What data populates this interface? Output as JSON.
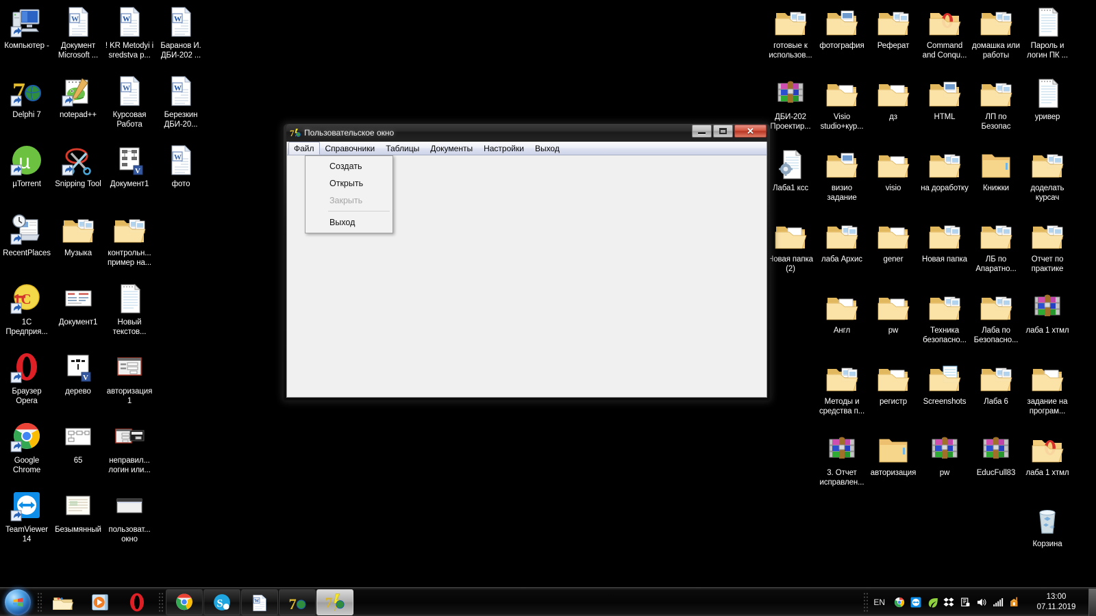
{
  "desktop": {
    "left_icons": [
      {
        "label": "Компьютер -",
        "icon": "computer-icon"
      },
      {
        "label": "Документ Microsoft ...",
        "icon": "word-document-icon"
      },
      {
        "label": "! KR Metodyi i sredstva p...",
        "icon": "word-doc-blue-icon"
      },
      {
        "label": "Баранов И. ДБИ-202 ...",
        "icon": "word-doc-blue-icon"
      },
      {
        "label": "Delphi 7",
        "icon": "delphi-icon"
      },
      {
        "label": "notepad++",
        "icon": "notepadpp-icon"
      },
      {
        "label": "Курсовая Работа",
        "icon": "word-document-icon"
      },
      {
        "label": "Березкин ДБИ-20...",
        "icon": "word-doc-blue-icon"
      },
      {
        "label": "µTorrent",
        "icon": "utorrent-icon"
      },
      {
        "label": "Snipping Tool",
        "icon": "snipping-tool-icon"
      },
      {
        "label": "Документ1",
        "icon": "visio-document-icon"
      },
      {
        "label": "фото",
        "icon": "word-document-icon"
      },
      {
        "label": "RecentPlaces",
        "icon": "recent-places-icon"
      },
      {
        "label": "Музыка",
        "icon": "folder-icon"
      },
      {
        "label": "контрольн... пример на...",
        "icon": "folder-icon"
      },
      {
        "label": "",
        "icon": "none"
      },
      {
        "label": "1С Предприя...",
        "icon": "1c-icon"
      },
      {
        "label": "Документ1",
        "icon": "image-thumb-icon"
      },
      {
        "label": "Новый текстов...",
        "icon": "text-file-icon"
      },
      {
        "label": "",
        "icon": "none"
      },
      {
        "label": "Браузер Opera",
        "icon": "opera-icon"
      },
      {
        "label": "дерево",
        "icon": "visio-thumb-icon"
      },
      {
        "label": "авторизация 1",
        "icon": "screenshot-thumb-icon"
      },
      {
        "label": "",
        "icon": "none"
      },
      {
        "label": "Google Chrome",
        "icon": "chrome-icon"
      },
      {
        "label": "65",
        "icon": "diagram-thumb-icon"
      },
      {
        "label": "неправил... логин или...",
        "icon": "dialog-thumb-icon"
      },
      {
        "label": "",
        "icon": "none"
      },
      {
        "label": "TeamViewer 14",
        "icon": "teamviewer-icon"
      },
      {
        "label": "Безымянный",
        "icon": "paper-thumb-icon"
      },
      {
        "label": "пользоват... окно",
        "icon": "window-thumb-icon"
      },
      {
        "label": "",
        "icon": "none"
      }
    ],
    "right_icons": [
      {
        "label": "готовые к использов...",
        "icon": "folder-icon"
      },
      {
        "label": "фотография",
        "icon": "folder-doc-icon"
      },
      {
        "label": "Реферат",
        "icon": "folder-icon"
      },
      {
        "label": "Command and Conqu...",
        "icon": "folder-opera-icon"
      },
      {
        "label": "домашка или работы",
        "icon": "folder-icon"
      },
      {
        "label": "Пароль и логин ПК ...",
        "icon": "text-file-icon"
      },
      {
        "label": "ДБИ-202 Проектир...",
        "icon": "winrar-icon"
      },
      {
        "label": "Visio studio+кур...",
        "icon": "folder-plain-icon"
      },
      {
        "label": "дз",
        "icon": "folder-plain-icon"
      },
      {
        "label": "HTML",
        "icon": "folder-doc-icon"
      },
      {
        "label": "ЛП по Безопас",
        "icon": "folder-icon"
      },
      {
        "label": "уривер",
        "icon": "text-file-icon"
      },
      {
        "label": "Лаба1 ксс",
        "icon": "config-file-icon"
      },
      {
        "label": "визио задание",
        "icon": "folder-doc-icon"
      },
      {
        "label": "visio",
        "icon": "folder-plain-icon"
      },
      {
        "label": "на доработку",
        "icon": "folder-icon"
      },
      {
        "label": "Книжки",
        "icon": "folder-empty-icon"
      },
      {
        "label": "доделать курсач",
        "icon": "folder-icon"
      },
      {
        "label": "Новая папка (2)",
        "icon": "folder-plain-icon"
      },
      {
        "label": "лаба Архис",
        "icon": "folder-icon"
      },
      {
        "label": "gener",
        "icon": "folder-plain-icon"
      },
      {
        "label": "Новая папка",
        "icon": "folder-icon"
      },
      {
        "label": "ЛБ по Апаратно...",
        "icon": "folder-icon"
      },
      {
        "label": "Отчет по практике",
        "icon": "folder-icon"
      },
      {
        "label": "",
        "icon": "none"
      },
      {
        "label": "Англ",
        "icon": "folder-plain-icon"
      },
      {
        "label": "pw",
        "icon": "folder-plain-icon"
      },
      {
        "label": "Техника безопасно...",
        "icon": "folder-icon"
      },
      {
        "label": "Лаба по Безопасно...",
        "icon": "folder-icon"
      },
      {
        "label": "лаба 1 хтмл",
        "icon": "winrar-icon"
      },
      {
        "label": "",
        "icon": "none"
      },
      {
        "label": "Методы и средства п...",
        "icon": "folder-icon"
      },
      {
        "label": "регистр",
        "icon": "folder-plain-icon"
      },
      {
        "label": "Screenshots",
        "icon": "folder-pics-icon"
      },
      {
        "label": "Лаба 6",
        "icon": "folder-icon"
      },
      {
        "label": "задание на програм...",
        "icon": "folder-plain-icon"
      },
      {
        "label": "",
        "icon": "none"
      },
      {
        "label": "3. Отчет исправлен...",
        "icon": "winrar-icon"
      },
      {
        "label": "авторизация",
        "icon": "folder-empty-icon"
      },
      {
        "label": "pw",
        "icon": "winrar-icon"
      },
      {
        "label": "EducFull83",
        "icon": "winrar-icon"
      },
      {
        "label": "лаба 1 хтмл",
        "icon": "folder-opera-icon"
      },
      {
        "label": "",
        "icon": "none"
      },
      {
        "label": "",
        "icon": "none"
      },
      {
        "label": "",
        "icon": "none"
      },
      {
        "label": "",
        "icon": "none"
      },
      {
        "label": "",
        "icon": "none"
      },
      {
        "label": "Корзина",
        "icon": "recycle-bin-icon"
      }
    ]
  },
  "window": {
    "title": "Пользовательское окно",
    "title_icon": "delphi-app-icon",
    "controls": {
      "minimize": "minimize-button",
      "maximize": "maximize-button",
      "close": "close-button"
    },
    "menubar": [
      {
        "label": "Файл",
        "open": true
      },
      {
        "label": "Справочники",
        "open": false
      },
      {
        "label": "Таблицы",
        "open": false
      },
      {
        "label": "Документы",
        "open": false
      },
      {
        "label": "Настройки",
        "open": false
      },
      {
        "label": "Выход",
        "open": false
      }
    ],
    "dropdown": {
      "owner": "Файл",
      "items": [
        {
          "label": "Создать",
          "disabled": false,
          "separator_after": false
        },
        {
          "label": "Открыть",
          "disabled": false,
          "separator_after": false
        },
        {
          "label": "Закрыть",
          "disabled": true,
          "separator_after": true
        },
        {
          "label": "Выход",
          "disabled": false,
          "separator_after": false
        }
      ]
    }
  },
  "taskbar": {
    "start_button": "start-orb",
    "quicklaunch": [
      {
        "name": "explorer-icon"
      },
      {
        "name": "media-player-icon"
      },
      {
        "name": "opera-icon"
      }
    ],
    "tasks": [
      {
        "name": "chrome-task",
        "active": false
      },
      {
        "name": "skype-task",
        "active": false
      },
      {
        "name": "word-task",
        "active": false
      },
      {
        "name": "delphi-task",
        "active": false
      },
      {
        "name": "delphi-app-task",
        "active": true
      }
    ],
    "tray": {
      "language": "EN",
      "icons": [
        {
          "name": "chrome-tray-icon"
        },
        {
          "name": "teamviewer-tray-icon"
        },
        {
          "name": "leaf-tray-icon"
        },
        {
          "name": "dropbox-tray-icon"
        },
        {
          "name": "action-center-tray-icon"
        },
        {
          "name": "volume-tray-icon"
        },
        {
          "name": "network-tray-icon"
        },
        {
          "name": "update-tray-icon"
        }
      ],
      "time": "13:00",
      "date": "07.11.2019"
    },
    "show_desktop": "show-desktop-button"
  },
  "colors": {
    "desktop_bg": "#000000",
    "menubar_top": "#fcfcfe",
    "menubar_bottom": "#ced4e9",
    "client_bg": "#f0f0f0",
    "close_button": "#b83524",
    "taskbar": "#050505",
    "icon_label": "#ffffff"
  }
}
